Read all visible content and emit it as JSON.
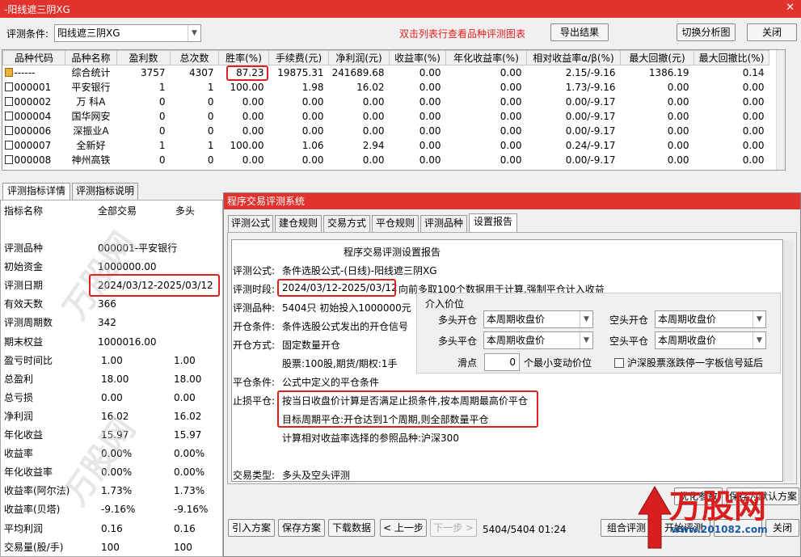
{
  "window": {
    "title": "-阳线遮三阴XG",
    "close_glyph": "✕"
  },
  "toolbar": {
    "condition_label": "评测条件:",
    "condition_value": "阳线遮三阴XG",
    "hint": "双击列表行查看品种评测图表",
    "export_label": "导出结果",
    "switch_label": "切换分析图",
    "close_label": "关闭"
  },
  "grid": {
    "columns": [
      "品种代码",
      "品种名称",
      "盈利数",
      "总次数",
      "胜率(%)",
      "手续费(元)",
      "净利润(元)",
      "收益率(%)",
      "年化收益率(%)",
      "相对收益率α/β(%)",
      "最大回撤(元)",
      "最大回撤比(%)"
    ],
    "rows": [
      {
        "code": "------",
        "name": "综合统计",
        "win": "3757",
        "total": "4307",
        "rate": "87.23",
        "fee": "19875.31",
        "net": "241689.68",
        "ret": "0.00",
        "annual": "0.00",
        "rel": "2.15/-9.16",
        "dd": "1386.19",
        "ddr": "0.14"
      },
      {
        "code": "000001",
        "name": "平安银行",
        "win": "1",
        "total": "1",
        "rate": "100.00",
        "fee": "1.98",
        "net": "16.02",
        "ret": "0.00",
        "annual": "0.00",
        "rel": "1.73/-9.16",
        "dd": "0.00",
        "ddr": "0.00"
      },
      {
        "code": "000002",
        "name": "万 科A",
        "win": "0",
        "total": "0",
        "rate": "0.00",
        "fee": "0.00",
        "net": "0.00",
        "ret": "0.00",
        "annual": "0.00",
        "rel": "0.00/-9.17",
        "dd": "0.00",
        "ddr": "0.00"
      },
      {
        "code": "000004",
        "name": "国华网安",
        "win": "0",
        "total": "0",
        "rate": "0.00",
        "fee": "0.00",
        "net": "0.00",
        "ret": "0.00",
        "annual": "0.00",
        "rel": "0.00/-9.17",
        "dd": "0.00",
        "ddr": "0.00"
      },
      {
        "code": "000006",
        "name": "深振业A",
        "win": "0",
        "total": "0",
        "rate": "0.00",
        "fee": "0.00",
        "net": "0.00",
        "ret": "0.00",
        "annual": "0.00",
        "rel": "0.00/-9.17",
        "dd": "0.00",
        "ddr": "0.00"
      },
      {
        "code": "000007",
        "name": "全新好",
        "win": "1",
        "total": "1",
        "rate": "100.00",
        "fee": "1.06",
        "net": "2.94",
        "ret": "0.00",
        "annual": "0.00",
        "rel": "0.24/-9.17",
        "dd": "0.00",
        "ddr": "0.00"
      },
      {
        "code": "000008",
        "name": "神州高铁",
        "win": "0",
        "total": "0",
        "rate": "0.00",
        "fee": "0.00",
        "net": "0.00",
        "ret": "0.00",
        "annual": "0.00",
        "rel": "0.00/-9.17",
        "dd": "0.00",
        "ddr": "0.00"
      }
    ]
  },
  "left_tabs": [
    "评测指标详情",
    "评测指标说明"
  ],
  "metrics": {
    "headers": [
      "指标名称",
      "全部交易",
      "多头"
    ],
    "rows": [
      {
        "name": "评测品种",
        "all": "000001-平安银行",
        "long": ""
      },
      {
        "name": "初始资金",
        "all": "1000000.00",
        "long": ""
      },
      {
        "name": "评测日期",
        "all": "2024/03/12-2025/03/12",
        "long": ""
      },
      {
        "name": "有效天数",
        "all": "366",
        "long": ""
      },
      {
        "name": "评测周期数",
        "all": "342",
        "long": ""
      },
      {
        "name": "期末权益",
        "all": "1000016.00",
        "long": ""
      },
      {
        "name": "盈亏时间比",
        "all": "1.00",
        "long": "1.00"
      },
      {
        "name": "总盈利",
        "all": "18.00",
        "long": "18.00"
      },
      {
        "name": "总亏损",
        "all": "0.00",
        "long": "0.00"
      },
      {
        "name": "净利润",
        "all": "16.02",
        "long": "16.02"
      },
      {
        "name": "年化收益",
        "all": "15.97",
        "long": "15.97"
      },
      {
        "name": "收益率",
        "all": "0.00%",
        "long": "0.00%"
      },
      {
        "name": "年化收益率",
        "all": "0.00%",
        "long": "0.00%"
      },
      {
        "name": "收益率(阿尔法)",
        "all": "1.73%",
        "long": "1.73%"
      },
      {
        "name": "收益率(贝塔)",
        "all": "-9.16%",
        "long": "-9.16%"
      },
      {
        "name": "平均利润",
        "all": "0.16",
        "long": "0.16"
      },
      {
        "name": "交易量(股/手)",
        "all": "100",
        "long": "100"
      }
    ]
  },
  "dialog": {
    "title": "程序交易评测系统",
    "tabs": [
      "评测公式",
      "建仓规则",
      "交易方式",
      "平仓规则",
      "评测品种",
      "设置报告"
    ],
    "report": {
      "heading": "程序交易评测设置报告",
      "formula_label": "评测公式:",
      "formula_value": "条件选股公式-(日线)-阳线遮三阴XG",
      "period_label": "评测时段:",
      "period_value": "2024/03/12-2025/03/12",
      "period_suffix": "向前多取100个数据用于计算,强制平仓计入收益",
      "varieties_label": "评测品种:",
      "varieties_value": "5404只 初始投入1000000元",
      "open_cond_label": "开仓条件:",
      "open_cond_value": "条件选股公式发出的开仓信号",
      "open_way_label": "开仓方式:",
      "open_way_value": "固定数量开仓",
      "open_way_detail": "股票:100股,期货/期权:1手",
      "close_cond_label": "平仓条件:",
      "close_cond_value": "公式中定义的平仓条件",
      "stop_label": "止损平仓:",
      "stop_value": "按当日收盘价计算是否满足止损条件,按本周期最高价平仓",
      "target_value": "目标周期平仓:开仓达到1个周期,则全部数量平仓",
      "ref_value": "计算相对收益率选择的参照品种:沪深300",
      "trade_type_label": "交易类型:",
      "trade_type_value": "多头及空头评测"
    },
    "price_group": {
      "label": "介入价位",
      "long_open_label": "多头开仓",
      "long_open_value": "本周期收盘价",
      "short_open_label": "空头开仓",
      "short_open_value": "本周期收盘价",
      "long_close_label": "多头平仓",
      "long_close_value": "本周期收盘价",
      "short_close_label": "空头平仓",
      "short_close_value": "本周期收盘价",
      "slip_label": "滑点",
      "slip_value": "0",
      "slip_unit": "个最小变动价位",
      "limit_check_label": "沪深股票涨跌停一字板信号延后"
    },
    "buttons": {
      "optimize": "优化参数",
      "save_default": "保存为默认方案",
      "import": "引入方案",
      "save": "保存方案",
      "download": "下载数据",
      "prev": "< 上一步",
      "next": "下一步 >",
      "progress": "5404/5404  01:24",
      "combo": "组合评测",
      "start": "开始评测",
      "close": "关闭"
    }
  },
  "watermark": {
    "brand": "万股网",
    "url": "www.201082.com"
  }
}
